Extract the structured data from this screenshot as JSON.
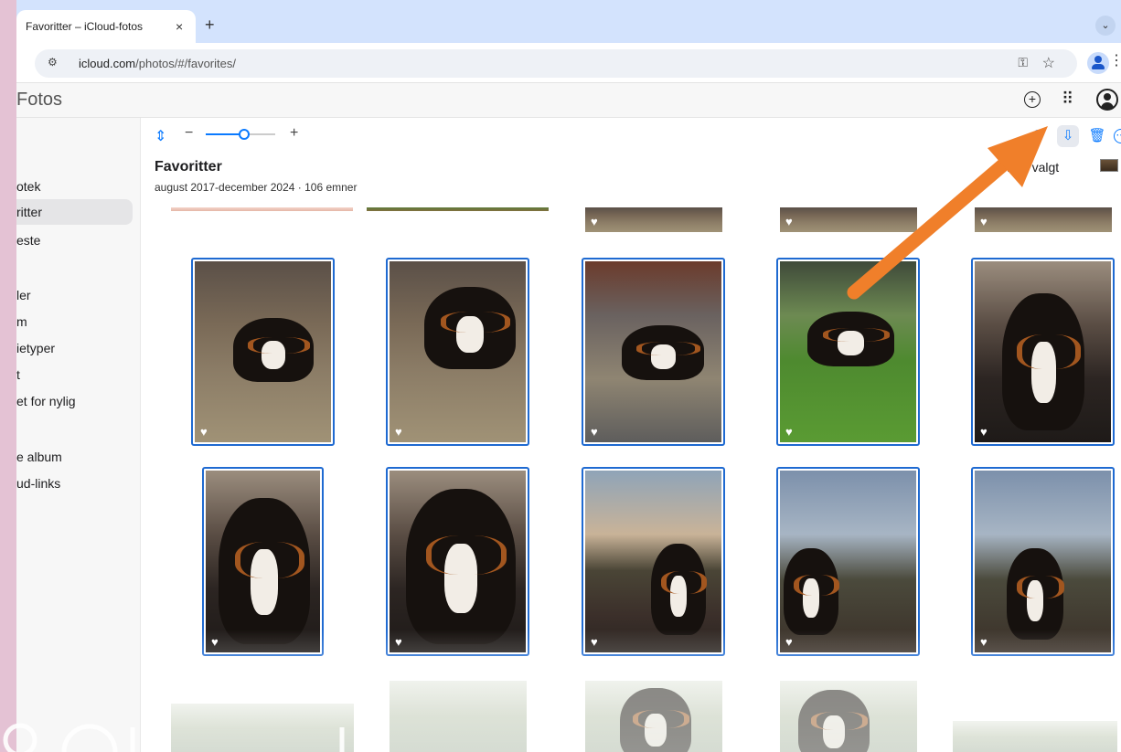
{
  "browser": {
    "tab_title": "Favoritter – iCloud-fotos",
    "tab_close": "×",
    "new_tab": "+",
    "tabs_dropdown": "⌄",
    "url_host": "icloud.com",
    "url_path": "/photos/#/favorites/",
    "site_info_icon": "tune-icon",
    "menu_icon": "⋮"
  },
  "app": {
    "title": "Fotos",
    "add_label": "+",
    "apps_label": "⠿"
  },
  "sidebar": {
    "items": [
      {
        "label": "otek"
      },
      {
        "label": "ritter"
      },
      {
        "label": "este"
      },
      {
        "label": "ler"
      },
      {
        "label": "m"
      },
      {
        "label": "ietyper"
      },
      {
        "label": "t"
      },
      {
        "label": "et for nylig"
      },
      {
        "label": "e album"
      },
      {
        "label": "ud-links"
      }
    ]
  },
  "toolbar": {
    "zoom_toggle": "⇕",
    "zoom_minus": "−",
    "zoom_plus": "+",
    "zoom_level": 0.55,
    "favorite_icon": "♡",
    "download_icon": "⇩",
    "delete_icon": "🗑",
    "more_icon": "⋯"
  },
  "album": {
    "title": "Favoritter",
    "subtitle": "august 2017-december 2024 · 106 emner",
    "selection_text": "emner valgt"
  },
  "photos": {
    "heart_glyph": "♥"
  },
  "colors": {
    "accent": "#0a7aff",
    "selection_border": "#1f6ad1",
    "arrow": "#f07f2a",
    "page_background": "#e4c2d4"
  }
}
